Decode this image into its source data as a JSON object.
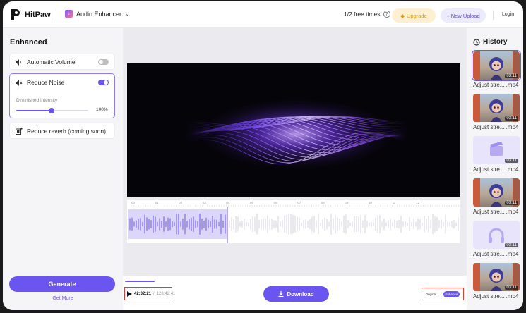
{
  "header": {
    "brand": "HitPaw",
    "product": "Audio Enhancer",
    "free_times": "1/2 free times",
    "upgrade": "Upgrade",
    "new_upload": "New Upload",
    "login": "Login"
  },
  "left": {
    "title": "Enhanced",
    "auto_volume": "Automatic Volume",
    "reduce_noise": "Reduce Noise",
    "diminished": "Diminished Intensity",
    "intensity_value": "100%",
    "intensity_fraction": 1.0,
    "reduce_reverb": "Reduce reverb (coming soon)",
    "generate": "Generate",
    "get_more": "Get More"
  },
  "ruler": [
    "00",
    "01",
    "02",
    "03",
    "04",
    "05",
    "06",
    "07",
    "08",
    "09",
    "10",
    "11",
    "12"
  ],
  "player": {
    "current": "42:32:21",
    "separator": "/",
    "total": "123:42:41",
    "download": "Download",
    "original": "Original",
    "enhance": "Enhance"
  },
  "history": {
    "title": "History",
    "items": [
      {
        "name": "Adjust stre... .mp4",
        "duration": "03:11",
        "kind": "video"
      },
      {
        "name": "Adjust stre... .mp4",
        "duration": "03:11",
        "kind": "video"
      },
      {
        "name": "Adjust stre... .mp4",
        "duration": "03:11",
        "kind": "clip-icon"
      },
      {
        "name": "Adjust stre... .mp4",
        "duration": "03:11",
        "kind": "video"
      },
      {
        "name": "Adjust stre... .mp4",
        "duration": "03:11",
        "kind": "audio-icon"
      },
      {
        "name": "Adjust stre... .mp4",
        "duration": "03:11",
        "kind": "video"
      }
    ]
  },
  "colors": {
    "accent": "#6b55f0",
    "upgrade": "#d79a14",
    "highlight_box": "#e53935"
  }
}
